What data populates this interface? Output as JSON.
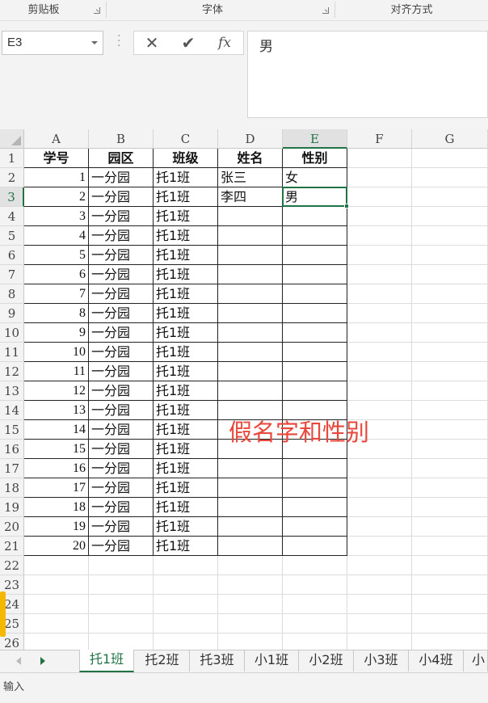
{
  "ribbon": {
    "groups": [
      {
        "label": "剪贴板"
      },
      {
        "label": "字体"
      },
      {
        "label": "对齐方式"
      }
    ]
  },
  "formula_bar": {
    "name_box": "E3",
    "cancel_icon": "✕",
    "enter_icon": "✔",
    "fx_icon": "fx",
    "content": "男"
  },
  "sheet": {
    "columns": [
      "A",
      "B",
      "C",
      "D",
      "E",
      "F",
      "G"
    ],
    "selected_cell": "E3",
    "rows": [
      {
        "num": "1",
        "a": "学号",
        "b": "园区",
        "c": "班级",
        "d": "姓名",
        "e": "性别"
      },
      {
        "num": "2",
        "a": "1",
        "b": "一分园",
        "c": "托1班",
        "d": "张三",
        "e": "女"
      },
      {
        "num": "3",
        "a": "2",
        "b": "一分园",
        "c": "托1班",
        "d": "李四",
        "e": "男"
      },
      {
        "num": "4",
        "a": "3",
        "b": "一分园",
        "c": "托1班",
        "d": "",
        "e": ""
      },
      {
        "num": "5",
        "a": "4",
        "b": "一分园",
        "c": "托1班",
        "d": "",
        "e": ""
      },
      {
        "num": "6",
        "a": "5",
        "b": "一分园",
        "c": "托1班",
        "d": "",
        "e": ""
      },
      {
        "num": "7",
        "a": "6",
        "b": "一分园",
        "c": "托1班",
        "d": "",
        "e": ""
      },
      {
        "num": "8",
        "a": "7",
        "b": "一分园",
        "c": "托1班",
        "d": "",
        "e": ""
      },
      {
        "num": "9",
        "a": "8",
        "b": "一分园",
        "c": "托1班",
        "d": "",
        "e": ""
      },
      {
        "num": "10",
        "a": "9",
        "b": "一分园",
        "c": "托1班",
        "d": "",
        "e": ""
      },
      {
        "num": "11",
        "a": "10",
        "b": "一分园",
        "c": "托1班",
        "d": "",
        "e": ""
      },
      {
        "num": "12",
        "a": "11",
        "b": "一分园",
        "c": "托1班",
        "d": "",
        "e": ""
      },
      {
        "num": "13",
        "a": "12",
        "b": "一分园",
        "c": "托1班",
        "d": "",
        "e": ""
      },
      {
        "num": "14",
        "a": "13",
        "b": "一分园",
        "c": "托1班",
        "d": "",
        "e": ""
      },
      {
        "num": "15",
        "a": "14",
        "b": "一分园",
        "c": "托1班",
        "d": "",
        "e": ""
      },
      {
        "num": "16",
        "a": "15",
        "b": "一分园",
        "c": "托1班",
        "d": "",
        "e": ""
      },
      {
        "num": "17",
        "a": "16",
        "b": "一分园",
        "c": "托1班",
        "d": "",
        "e": ""
      },
      {
        "num": "18",
        "a": "17",
        "b": "一分园",
        "c": "托1班",
        "d": "",
        "e": ""
      },
      {
        "num": "19",
        "a": "18",
        "b": "一分园",
        "c": "托1班",
        "d": "",
        "e": ""
      },
      {
        "num": "20",
        "a": "19",
        "b": "一分园",
        "c": "托1班",
        "d": "",
        "e": ""
      },
      {
        "num": "21",
        "a": "20",
        "b": "一分园",
        "c": "托1班",
        "d": "",
        "e": ""
      },
      {
        "num": "22",
        "a": "",
        "b": "",
        "c": "",
        "d": "",
        "e": ""
      },
      {
        "num": "23",
        "a": "",
        "b": "",
        "c": "",
        "d": "",
        "e": ""
      },
      {
        "num": "24",
        "a": "",
        "b": "",
        "c": "",
        "d": "",
        "e": ""
      },
      {
        "num": "25",
        "a": "",
        "b": "",
        "c": "",
        "d": "",
        "e": ""
      },
      {
        "num": "26",
        "a": "",
        "b": "",
        "c": "",
        "d": "",
        "e": ""
      }
    ],
    "overlay_text": "假名字和性别"
  },
  "sheet_tabs": {
    "items": [
      "托1班",
      "托2班",
      "托3班",
      "小1班",
      "小2班",
      "小3班",
      "小4班",
      "小"
    ],
    "active_index": 0
  },
  "status_bar": {
    "mode": "输入"
  },
  "colors": {
    "accent": "#217346",
    "overlay": "#e8473c"
  }
}
